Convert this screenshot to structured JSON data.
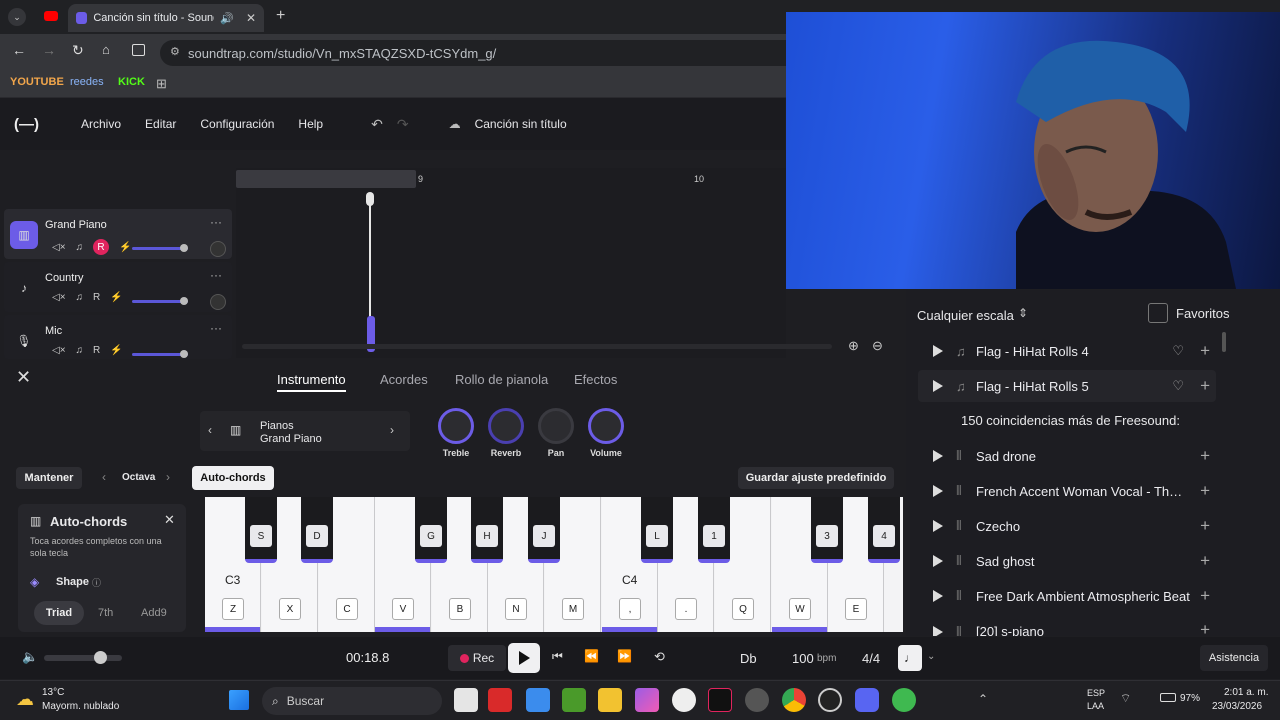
{
  "browser": {
    "tab_title": "Canción sin título - Soundtrap",
    "url": "soundtrap.com/studio/Vn_mxSTAQZSXD-tCSYdm_g/",
    "bookmarks": [
      "YOUTUBE",
      "reedes",
      "KICK"
    ]
  },
  "app": {
    "menu": [
      "Archivo",
      "Editar",
      "Configuración",
      "Help"
    ],
    "song_title": "Canción sin título",
    "ruler": [
      "9",
      "10"
    ]
  },
  "tracks": [
    {
      "name": "Grand Piano",
      "icon": "piano-icon",
      "rec": "R"
    },
    {
      "name": "Country",
      "icon": "guitar-icon",
      "rec": "R"
    },
    {
      "name": "Mic",
      "icon": "mic-icon",
      "rec": "R"
    }
  ],
  "panel": {
    "tabs": [
      "Instrumento",
      "Acordes",
      "Rollo de pianola",
      "Efectos"
    ],
    "instrument_category": "Pianos",
    "instrument_name": "Grand Piano",
    "knobs": [
      "Treble",
      "Reverb",
      "Pan",
      "Volume"
    ],
    "mantener": "Mantener",
    "octava": "Octava",
    "autochords": "Auto-chords",
    "guardar": "Guardar ajuste predefinido",
    "ac_title": "Auto-chords",
    "ac_desc": "Toca acordes completos con una sola tecla",
    "shape": "Shape",
    "shape_options": [
      "Triad",
      "7th",
      "Add9"
    ]
  },
  "piano": {
    "white_keys": [
      "Z",
      "X",
      "C",
      "V",
      "B",
      "N",
      "M",
      ",",
      ".",
      "Q",
      "W",
      "E"
    ],
    "black_keys": [
      "S",
      "D",
      "G",
      "H",
      "J",
      "L",
      "1",
      "3",
      "4"
    ],
    "c3": "C3",
    "c4": "C4"
  },
  "sounds": {
    "scale_filter": "Cualquier escala",
    "favorites": "Favoritos",
    "items_top": [
      "Flag - HiHat Rolls 4",
      "Flag - HiHat Rolls 5"
    ],
    "freesound_header": "150 coincidencias más de Freesound:",
    "items": [
      "Sad drone",
      "French Accent Woman Vocal - Ther...",
      "Czecho",
      "Sad ghost",
      "Free Dark Ambient Atmospheric Beat",
      "[20] s-piano"
    ]
  },
  "transport": {
    "time": "00:18.8",
    "rec": "Rec",
    "key": "Db",
    "bpm": "100",
    "bpm_unit": "bpm",
    "signature": "4/4",
    "help": "Asistencia"
  },
  "taskbar": {
    "temp": "13°C",
    "weather": "Mayorm. nublado",
    "search": "Buscar",
    "lang": "ESP",
    "lang2": "LAA",
    "battery": "97%",
    "time": "2:01 a. m.",
    "date": "23/03/2026"
  },
  "colors": {
    "accent": "#6c5ce7",
    "rec": "#e0245e"
  }
}
